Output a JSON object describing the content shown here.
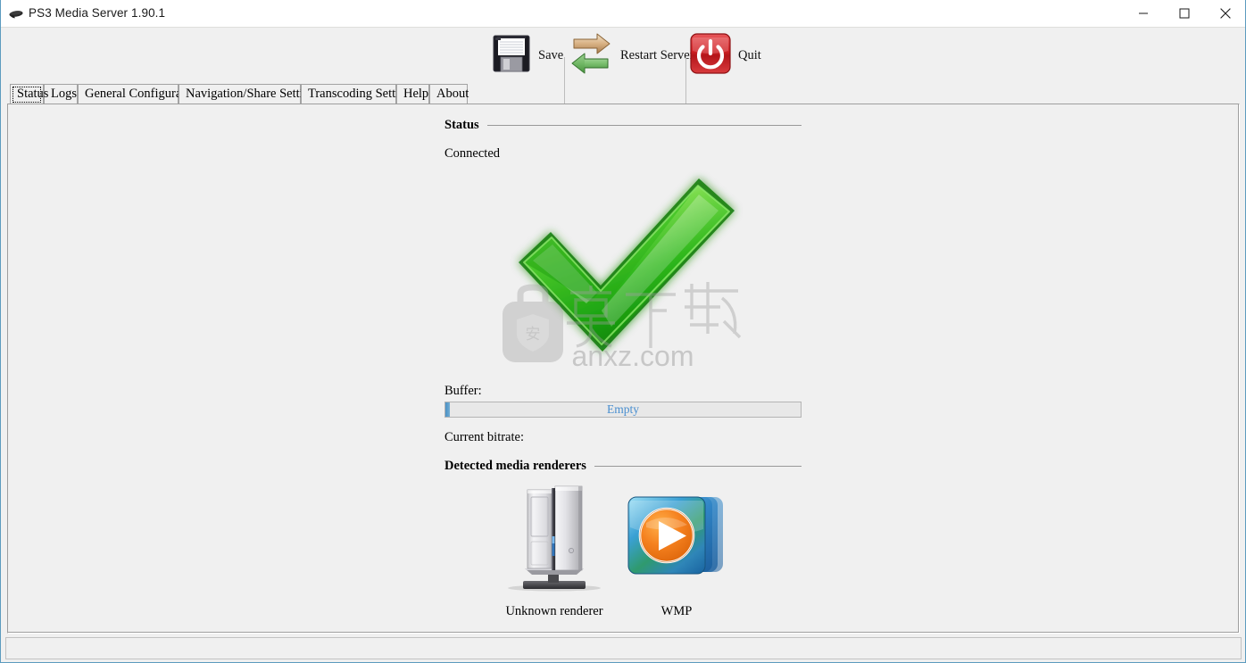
{
  "window": {
    "title": "PS3 Media Server 1.90.1",
    "icon": "ps3-logo-icon",
    "controls": {
      "minimize": "minimize-icon",
      "maximize": "maximize-icon",
      "close": "close-icon"
    }
  },
  "toolbar": {
    "items": [
      {
        "label": "Save",
        "icon": "floppy-disk-icon"
      },
      {
        "label": "Restart Server",
        "icon": "refresh-arrows-icon"
      },
      {
        "label": "Quit",
        "icon": "power-button-icon"
      }
    ]
  },
  "tabs": {
    "selected": "Status",
    "items": [
      {
        "label": "Status"
      },
      {
        "label": "Logs"
      },
      {
        "label": "General Configuration"
      },
      {
        "label": "Navigation/Share Settings"
      },
      {
        "label": "Transcoding Settings"
      },
      {
        "label": "Help"
      },
      {
        "label": "About"
      }
    ]
  },
  "status_panel": {
    "section_title": "Status",
    "connection_state": "Connected",
    "state_icon": "green-checkmark-icon",
    "buffer_label": "Buffer:",
    "buffer_value": "Empty",
    "buffer_percent": 0,
    "bitrate_label": "Current bitrate:",
    "bitrate_value": ""
  },
  "renderers_panel": {
    "section_title": "Detected media renderers",
    "items": [
      {
        "name": "Unknown renderer",
        "icon": "desktop-tower-icon"
      },
      {
        "name": "WMP",
        "icon": "windows-media-player-icon"
      }
    ]
  },
  "watermark": {
    "text": "anxz.com",
    "cn_text": "安下载"
  },
  "colors": {
    "window_border": "#5c9bbf",
    "panel_bg": "#f0f0f0",
    "buffer_accent": "#4a8fd0",
    "check_green": "#35c023",
    "quit_red": "#cf1f23"
  }
}
